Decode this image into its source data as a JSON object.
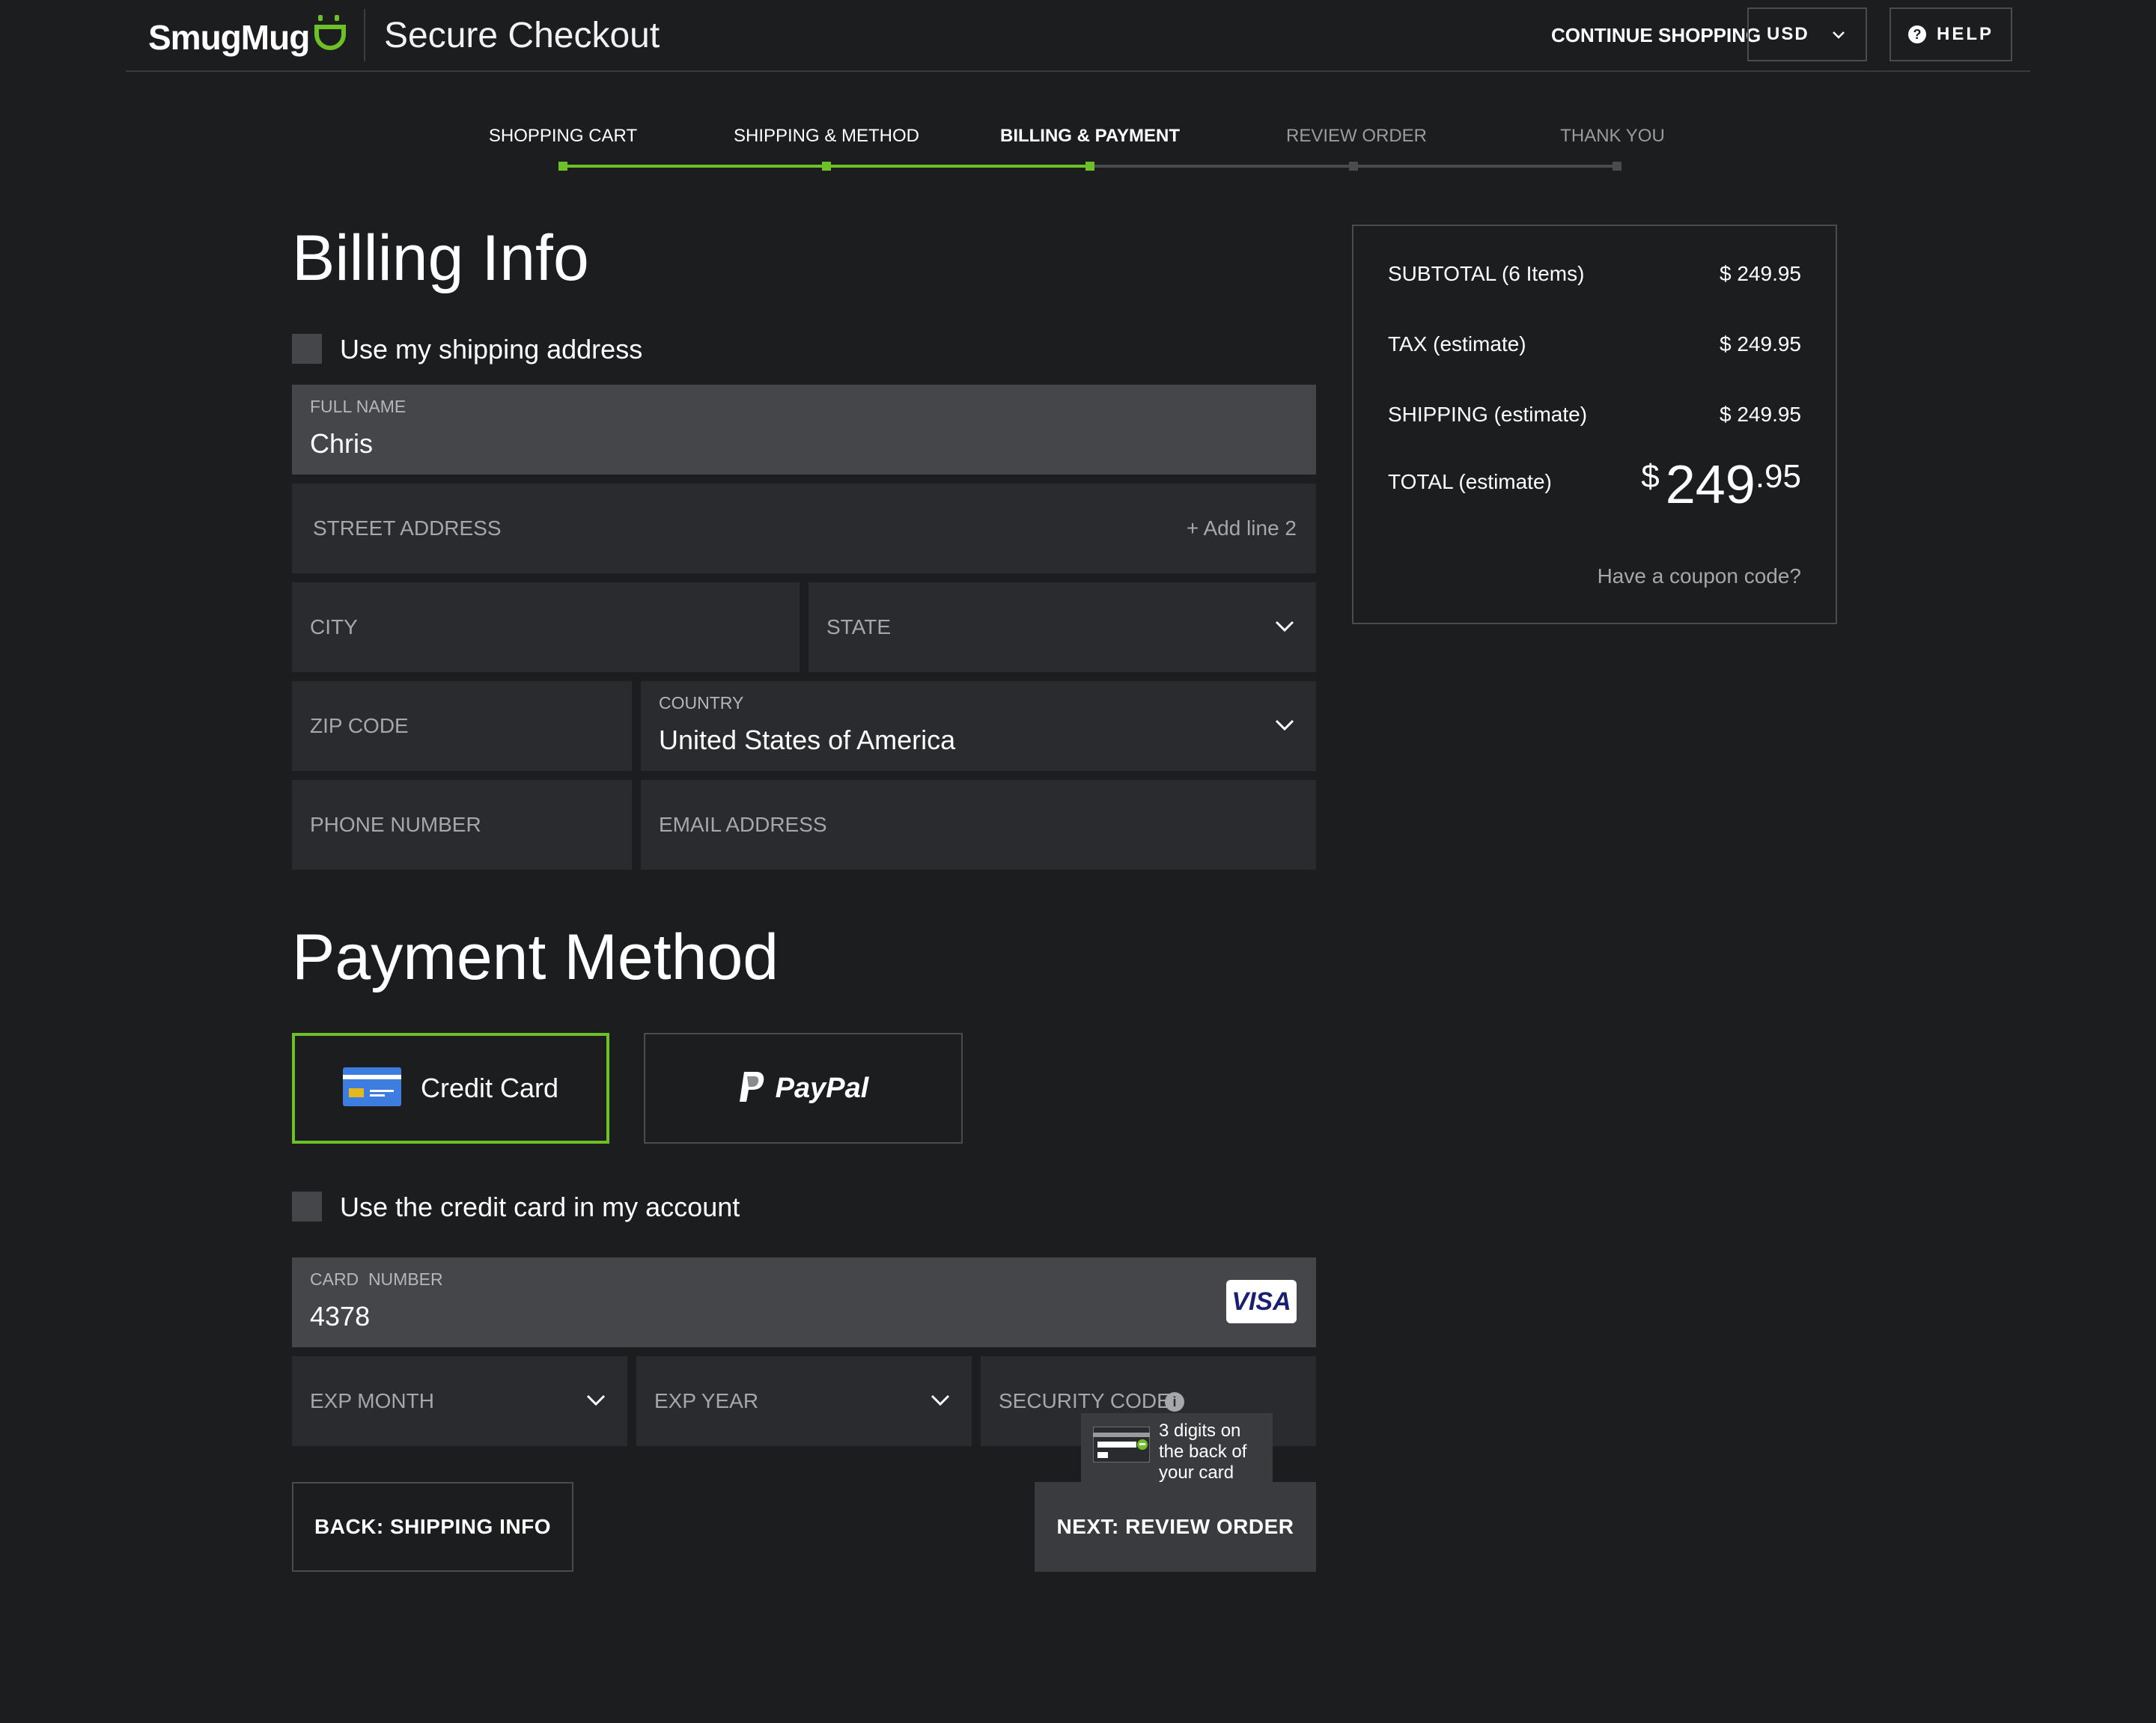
{
  "header": {
    "brand": "SmugMug",
    "title": "Secure Checkout",
    "continue_label": "CONTINUE SHOPPING",
    "currency": "USD",
    "help_label": "HELP"
  },
  "steps": [
    {
      "label": "SHOPPING CART",
      "state": "done"
    },
    {
      "label": "SHIPPING & METHOD",
      "state": "done"
    },
    {
      "label": "BILLING & PAYMENT",
      "state": "current"
    },
    {
      "label": "REVIEW ORDER",
      "state": "todo"
    },
    {
      "label": "THANK YOU",
      "state": "todo"
    }
  ],
  "billing": {
    "heading": "Billing Info",
    "use_shipping_label": "Use my shipping address",
    "full_name_label": "FULL NAME",
    "full_name_value": "Chris",
    "street_label": "STREET ADDRESS",
    "add_line_label": "+ Add line 2",
    "city_label": "CITY",
    "state_label": "STATE",
    "zip_label": "ZIP CODE",
    "country_label": "COUNTRY",
    "country_value": "United States of America",
    "phone_label": "PHONE NUMBER",
    "email_label": "EMAIL ADDRESS"
  },
  "payment": {
    "heading": "Payment Method",
    "credit_card_label": "Credit Card",
    "paypal_label": "PayPal",
    "use_account_card_label": "Use the credit card in my account",
    "card_number_label": "CARD  NUMBER",
    "card_number_value": "4378",
    "card_brand": "VISA",
    "exp_month_label": "EXP MONTH",
    "exp_year_label": "EXP YEAR",
    "security_code_label": "SECURITY CODE",
    "tooltip_text": "3 digits on the back of your card"
  },
  "buttons": {
    "back_label": "BACK: SHIPPING INFO",
    "next_label": "NEXT: REVIEW ORDER"
  },
  "summary": {
    "subtotal_label": "SUBTOTAL (6 Items)",
    "subtotal_value": "$ 249.95",
    "tax_label": "TAX (estimate)",
    "tax_value": "$ 249.95",
    "shipping_label": "SHIPPING (estimate)",
    "shipping_value": "$ 249.95",
    "total_label": "TOTAL (estimate)",
    "total_currency": "$",
    "total_whole": "249",
    "total_cents": ".95",
    "coupon_label": "Have a coupon code?"
  },
  "colors": {
    "accent": "#6ec027",
    "background": "#1c1d1f",
    "field": "#2a2b2e",
    "field_filled": "#45464a"
  }
}
